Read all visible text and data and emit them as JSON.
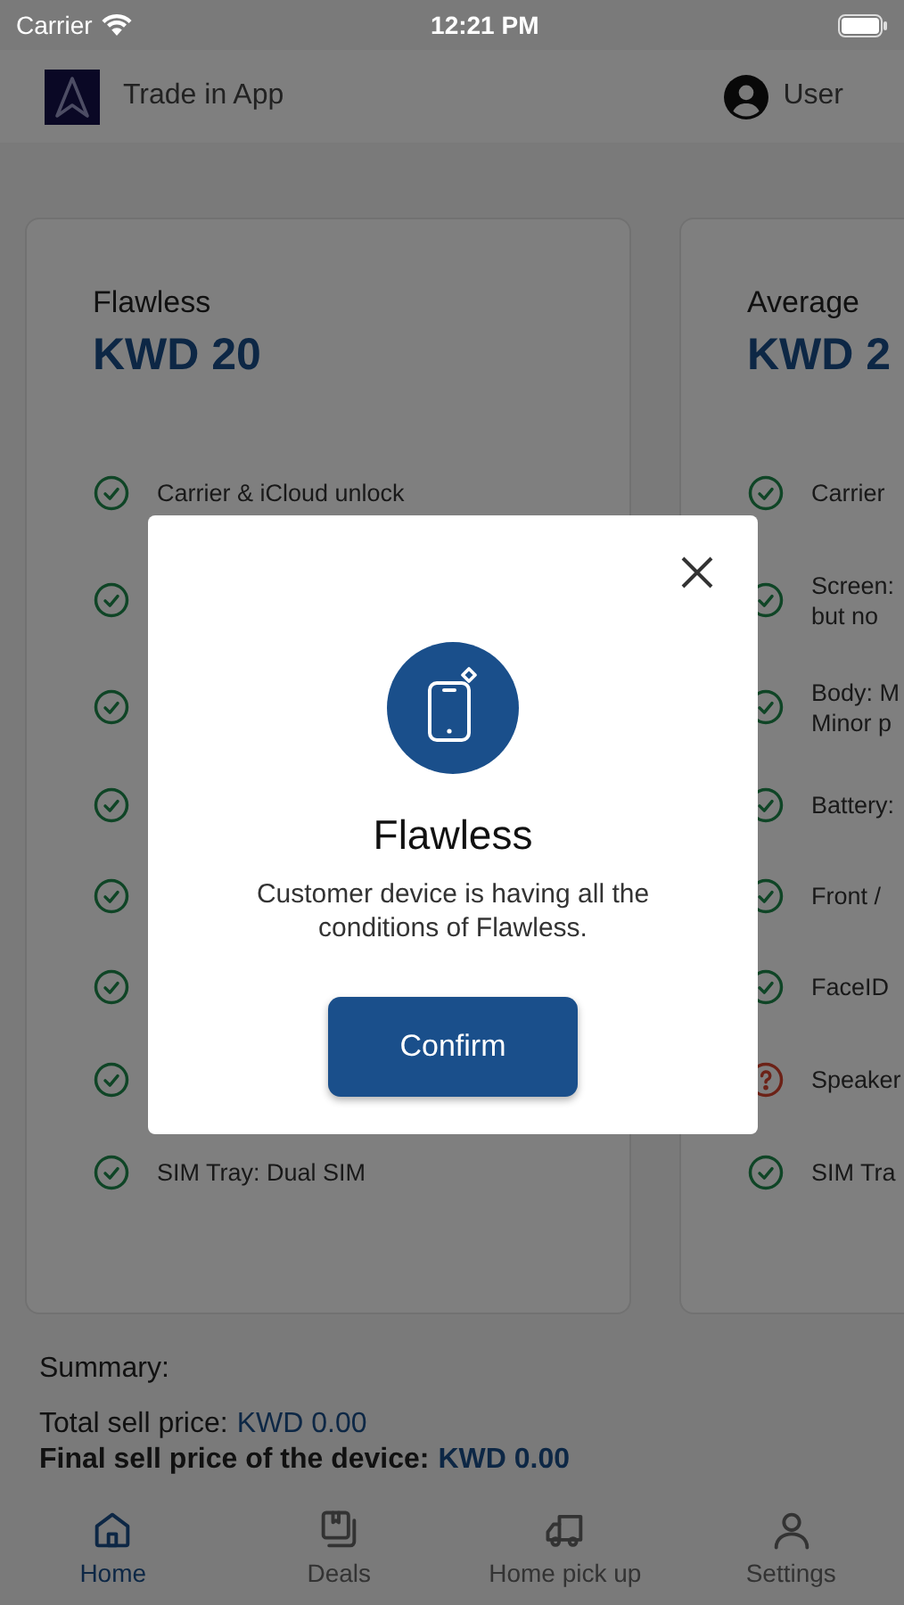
{
  "status_bar": {
    "carrier": "Carrier",
    "time": "12:21 PM"
  },
  "header": {
    "app_name": "Trade in App",
    "user": "User"
  },
  "cards": [
    {
      "grade": "Flawless",
      "price": "KWD 20",
      "items": [
        {
          "kind": "check",
          "label": "Carrier & iCloud unlock"
        },
        {
          "kind": "check"
        },
        {
          "kind": "check"
        },
        {
          "kind": "check"
        },
        {
          "kind": "check"
        },
        {
          "kind": "check"
        },
        {
          "kind": "check"
        },
        {
          "kind": "check",
          "label": "SIM Tray: Dual SIM"
        }
      ]
    },
    {
      "grade": "Average",
      "price": "KWD 2",
      "items": [
        {
          "kind": "check",
          "label": "Carrier"
        },
        {
          "kind": "check",
          "label": "Screen:\nbut no"
        },
        {
          "kind": "check",
          "label": "Body: M\nMinor p"
        },
        {
          "kind": "check",
          "label": "Battery:"
        },
        {
          "kind": "check",
          "label": "Front /"
        },
        {
          "kind": "check",
          "label": "FaceID"
        },
        {
          "kind": "question",
          "label": "Speaker"
        },
        {
          "kind": "check",
          "label": "SIM Tra"
        }
      ]
    }
  ],
  "summary": {
    "title": "Summary:",
    "lines": [
      {
        "label": "Total sell price:",
        "value": "KWD 0.00",
        "bold": false
      },
      {
        "label": "Final sell price of the device:",
        "value": "KWD 0.00",
        "bold": true
      }
    ]
  },
  "tabs": [
    {
      "label": "Home",
      "selected": true
    },
    {
      "label": "Deals",
      "selected": false
    },
    {
      "label": "Home pick up",
      "selected": false
    },
    {
      "label": "Settings",
      "selected": false
    }
  ],
  "modal": {
    "title": "Flawless",
    "message": "Customer device is having all the conditions of Flawless.",
    "button": "Confirm"
  }
}
